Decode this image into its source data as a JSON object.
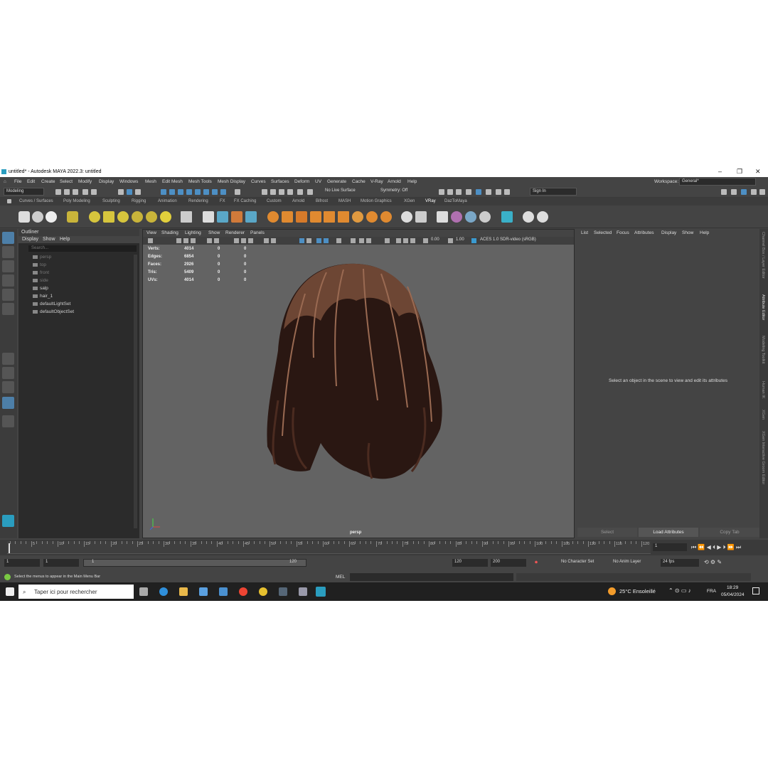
{
  "title": "untitled* - Autodesk MAYA 2022.3: untitled",
  "menu": [
    "File",
    "Edit",
    "Create",
    "Select",
    "Modify",
    "Display",
    "Windows",
    "Mesh",
    "Edit Mesh",
    "Mesh Tools",
    "Mesh Display",
    "Curves",
    "Surfaces",
    "Deform",
    "UV",
    "Generate",
    "Cache",
    "V-Ray",
    "Arnold",
    "Help"
  ],
  "workspace": {
    "label": "Workspace:",
    "value": "General*"
  },
  "status": {
    "mode": "Modeling",
    "live_surface": "No Live Surface",
    "symmetry": "Symmetry: Off",
    "sign_in": "Sign In"
  },
  "shelf_tabs": [
    "Curves / Surfaces",
    "Poly Modeling",
    "Sculpting",
    "Rigging",
    "Animation",
    "Rendering",
    "FX",
    "FX Caching",
    "Custom",
    "Arnold",
    "Bifrost",
    "MASH",
    "Motion Graphics",
    "XGen",
    "VRay",
    "DazToMaya"
  ],
  "active_shelf": "VRay",
  "outliner": {
    "title": "Outliner",
    "menu": [
      "Display",
      "Show",
      "Help"
    ],
    "search_placeholder": "Search...",
    "items": [
      {
        "name": "persp",
        "dim": true
      },
      {
        "name": "top",
        "dim": true
      },
      {
        "name": "front",
        "dim": true
      },
      {
        "name": "side",
        "dim": true
      },
      {
        "name": "salp",
        "dim": false
      },
      {
        "name": "hair_1",
        "dim": false
      },
      {
        "name": "defaultLightSet",
        "dim": false
      },
      {
        "name": "defaultObjectSet",
        "dim": false
      }
    ]
  },
  "viewport": {
    "menu": [
      "View",
      "Shading",
      "Lighting",
      "Show",
      "Renderer",
      "Panels"
    ],
    "exposure": "0.00",
    "gamma": "1.00",
    "color_space": "ACES 1.0 SDR-video (sRGB)",
    "camera": "persp",
    "hud": [
      {
        "label": "Verts:",
        "v1": "4014",
        "v2": "0",
        "v3": "0"
      },
      {
        "label": "Edges:",
        "v1": "6854",
        "v2": "0",
        "v3": "0"
      },
      {
        "label": "Faces:",
        "v1": "2926",
        "v2": "0",
        "v3": "0"
      },
      {
        "label": "Tris:",
        "v1": "5409",
        "v2": "0",
        "v3": "0"
      },
      {
        "label": "UVs:",
        "v1": "4014",
        "v2": "0",
        "v3": "0"
      }
    ]
  },
  "attribute_editor": {
    "menu": [
      "List",
      "Selected",
      "Focus",
      "Attributes",
      "Display",
      "Show",
      "Help"
    ],
    "message": "Select an object in the scene to view and edit its attributes",
    "buttons": [
      "Select",
      "Load Attributes",
      "Copy Tab"
    ]
  },
  "side_tabs": [
    "Channel Box / Layer Editor",
    "Attribute Editor",
    "Modeling Toolkit",
    "Human IK",
    "XGen",
    "XGen Interactive Groom Editor"
  ],
  "timeline": {
    "ticks": [
      "5",
      "10",
      "15",
      "20",
      "25",
      "30",
      "35",
      "40",
      "45",
      "50",
      "55",
      "60",
      "65",
      "70",
      "75",
      "80",
      "85",
      "90",
      "95",
      "100",
      "105",
      "110",
      "115",
      "120"
    ],
    "current_frame": "1"
  },
  "range": {
    "start": "1",
    "anim_start": "1",
    "slider_start": "1",
    "slider_end": "120",
    "anim_end": "120",
    "end": "200",
    "character_set": "No Character Set",
    "anim_layer": "No Anim Layer",
    "fps": "24 fps"
  },
  "command": {
    "help_line": "Select the menus to appear in the Main Menu Bar",
    "lang": "MEL"
  },
  "taskbar": {
    "search": "Taper ici pour rechercher",
    "weather": "25°C  Ensoleillé",
    "lang": "FRA",
    "time": "18:29",
    "date": "05/04/2024"
  }
}
